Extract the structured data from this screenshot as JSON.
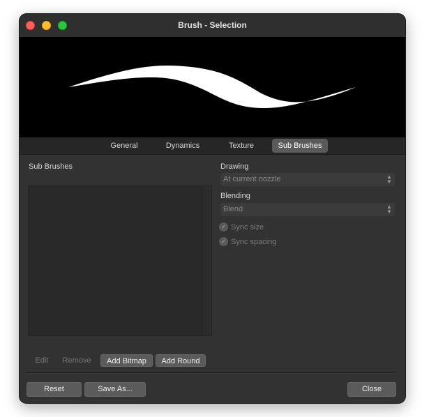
{
  "window": {
    "title": "Brush - Selection"
  },
  "tabs": [
    {
      "label": "General",
      "active": false
    },
    {
      "label": "Dynamics",
      "active": false
    },
    {
      "label": "Texture",
      "active": false
    },
    {
      "label": "Sub Brushes",
      "active": true
    }
  ],
  "left_panel": {
    "heading": "Sub Brushes",
    "buttons": {
      "edit": "Edit",
      "remove": "Remove",
      "add_bitmap": "Add Bitmap",
      "add_round": "Add Round"
    }
  },
  "right_panel": {
    "drawing_label": "Drawing",
    "drawing_value": "At current nozzle",
    "blending_label": "Blending",
    "blending_value": "Blend",
    "sync_size": {
      "label": "Sync size",
      "checked": true
    },
    "sync_spacing": {
      "label": "Sync spacing",
      "checked": true
    }
  },
  "footer": {
    "reset": "Reset",
    "save_as": "Save As...",
    "close": "Close"
  },
  "icons": {
    "checkmark": "✓",
    "select_chevron": "up-down-chevron-icon"
  },
  "colors": {
    "window_bg": "#323232",
    "preview_bg": "#000000",
    "active_tab": "#5a5a5a"
  }
}
